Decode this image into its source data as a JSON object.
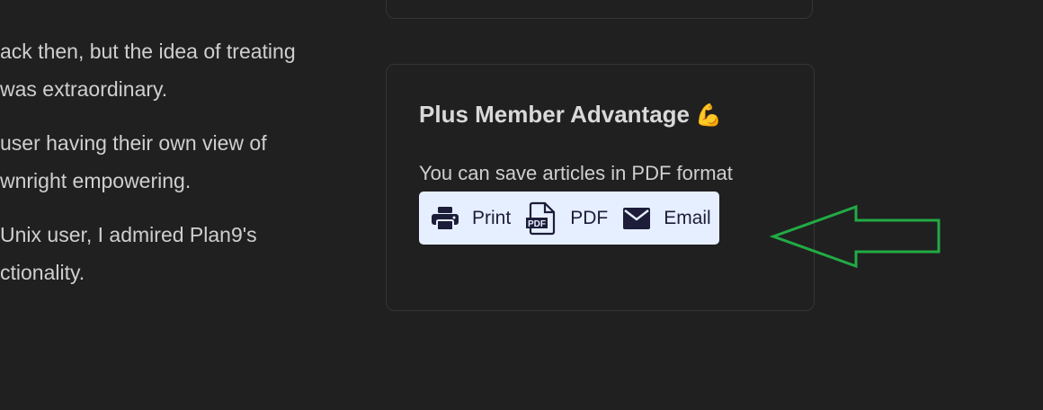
{
  "article": {
    "paragraphs": [
      [
        "ack then, but the idea of treating",
        "was extraordinary."
      ],
      [
        "user having their own view of",
        "wnright empowering."
      ],
      [
        "Unix user, I admired Plan9's",
        "ctionality."
      ]
    ]
  },
  "plus_card": {
    "title": "Plus Member Advantage",
    "emoji": "💪",
    "description": "You can save articles in PDF format",
    "actions": {
      "print_label": "Print",
      "pdf_label": "PDF",
      "email_label": "Email"
    }
  },
  "icons": {
    "print": "printer-icon",
    "pdf": "pdf-file-icon",
    "email": "envelope-icon",
    "annotation": "green-arrow-left"
  },
  "colors": {
    "background": "#202020",
    "card_border": "#353535",
    "share_bar": "#e6efff",
    "icon": "#1d1d3a",
    "arrow": "#22aa44"
  }
}
